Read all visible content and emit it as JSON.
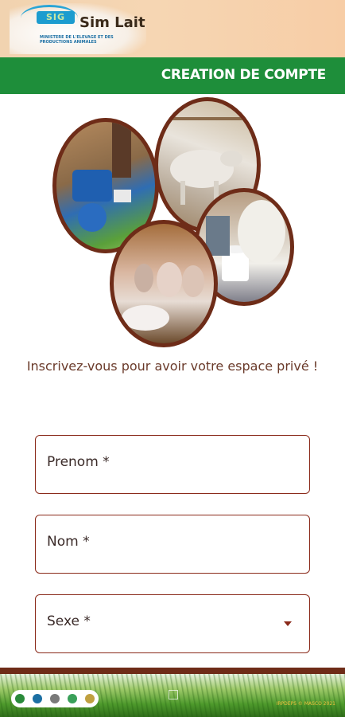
{
  "app": {
    "logo_badge": "SIG",
    "logo_title": "Sim Lait",
    "logo_subtitle": "MINISTERE DE L'ELEVAGE ET DES PRODUCTIONS ANIMALES"
  },
  "header": {
    "title": "CREATION DE COMPTE"
  },
  "tagline": "Inscrivez-vous pour avoir votre espace privé !",
  "form": {
    "prenom_label": "Prenom *",
    "nom_label": "Nom *",
    "sexe_label": "Sexe *"
  },
  "footer": {
    "copyright": "IRPDEPS  © MASCO 2021"
  },
  "colors": {
    "brand_green": "#1e8e3a",
    "brand_brown": "#6e2c18",
    "field_border": "#8a2a1a"
  }
}
